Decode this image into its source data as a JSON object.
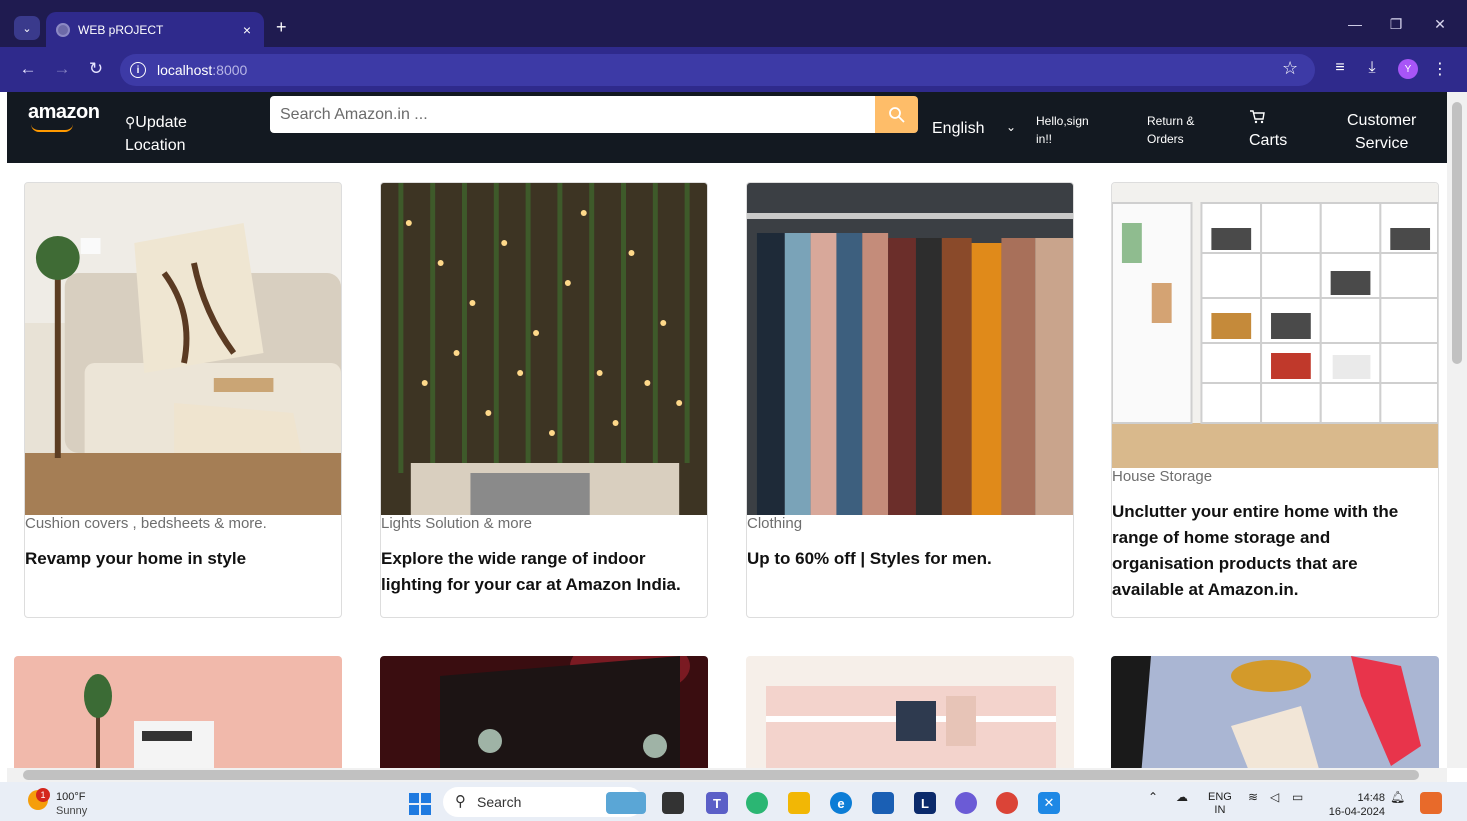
{
  "browser": {
    "tab_title": "WEB pROJECT",
    "tab_close": "×",
    "new_tab": "+",
    "url_host": "localhost",
    "url_port": ":8000",
    "profile_initial": "Y",
    "controls": {
      "minimize": "—",
      "restore": "❐",
      "close": "✕"
    }
  },
  "header": {
    "logo": "amazon",
    "location_line1": "Update",
    "location_line2": "Location",
    "search_placeholder": "Search Amazon.in ...",
    "language": "English",
    "account_line1": "Hello,sign",
    "account_line2": "in!!",
    "returns_line1": "Return &",
    "returns_line2": "Orders",
    "cart": "Carts",
    "service_line1": "Customer",
    "service_line2": "Service",
    "accent_color": "#febd69",
    "bg_color": "#131921"
  },
  "cards": [
    {
      "category": "Cushion covers , bedsheets & more.",
      "title": "Revamp your home in style"
    },
    {
      "category": "Lights Solution & more",
      "title": "Explore the wide range of indoor lighting for your car at Amazon India."
    },
    {
      "category": "Clothing",
      "title": "Up to 60% off | Styles for men."
    },
    {
      "category": "House Storage",
      "title": "Unclutter your entire home with the range of home storage and organisation products that are available at Amazon.in."
    }
  ],
  "taskbar": {
    "weather_temp": "100°F",
    "weather_condition": "Sunny",
    "weather_badge": "1",
    "search_label": "Search",
    "lang_line1": "ENG",
    "lang_line2": "IN",
    "time": "14:48",
    "date": "16-04-2024"
  }
}
